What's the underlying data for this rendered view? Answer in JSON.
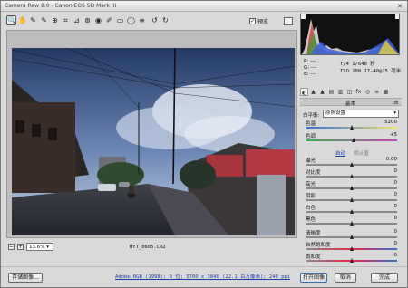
{
  "window": {
    "title": "Camera Raw 8.0 - Canon EOS 5D Mark III"
  },
  "toolbar": {
    "tools": [
      {
        "icon": "zoom-icon",
        "glyph": "🔍",
        "active": true
      },
      {
        "icon": "hand-icon",
        "glyph": "✋"
      },
      {
        "icon": "white-balance-icon",
        "glyph": "✎"
      },
      {
        "icon": "color-sampler-icon",
        "glyph": "✎"
      },
      {
        "icon": "targeted-adjustment-icon",
        "glyph": "⊕"
      },
      {
        "icon": "crop-icon",
        "glyph": "⌗"
      },
      {
        "icon": "straighten-icon",
        "glyph": "⊿"
      },
      {
        "icon": "spot-removal-icon",
        "glyph": "⊛"
      },
      {
        "icon": "red-eye-icon",
        "glyph": "◉"
      },
      {
        "icon": "adjustment-brush-icon",
        "glyph": "✐"
      },
      {
        "icon": "graduated-filter-icon",
        "glyph": "▭"
      },
      {
        "icon": "radial-filter-icon",
        "glyph": "◯"
      },
      {
        "icon": "preferences-icon",
        "glyph": "≡"
      },
      {
        "icon": "rotate-ccw-icon",
        "glyph": "↺"
      },
      {
        "icon": "rotate-cw-icon",
        "glyph": "↻"
      }
    ],
    "preview_label": "预览",
    "preview_checked": true
  },
  "status": {
    "zoom_value": "13.6%",
    "filename": "HYT_0605.CR2"
  },
  "histogram_readout": {
    "r": "R: ---",
    "g": "G: ---",
    "b": "B: ---",
    "exposure_line": "f/4   1/640 秒",
    "iso_line": "ISO 200  17-40@25 毫米"
  },
  "panel": {
    "title": "基本",
    "white_balance_label": "白平衡:",
    "white_balance_value": "原照设置",
    "auto_label": "自动",
    "default_label": "默认值",
    "sliders": [
      {
        "label": "色温",
        "value": "5200",
        "pos": 0.5
      },
      {
        "label": "色调",
        "value": "+5",
        "pos": 0.52
      },
      {
        "label": "曝光",
        "value": "0.00",
        "pos": 0.5
      },
      {
        "label": "对比度",
        "value": "0",
        "pos": 0.5
      },
      {
        "label": "高光",
        "value": "0",
        "pos": 0.5
      },
      {
        "label": "阴影",
        "value": "0",
        "pos": 0.5
      },
      {
        "label": "白色",
        "value": "0",
        "pos": 0.5
      },
      {
        "label": "黑色",
        "value": "0",
        "pos": 0.5
      },
      {
        "label": "清晰度",
        "value": "0",
        "pos": 0.5
      },
      {
        "label": "自然饱和度",
        "value": "0",
        "pos": 0.5
      },
      {
        "label": "饱和度",
        "value": "0",
        "pos": 0.5
      }
    ]
  },
  "footer": {
    "save_label": "存储图像...",
    "workflow_link": "Adobe RGB (1998); 8 位; 5760 x 3840 (22.1 百万像素); 240 ppi",
    "open_label": "打开图像",
    "cancel_label": "取消",
    "done_label": "完成"
  }
}
